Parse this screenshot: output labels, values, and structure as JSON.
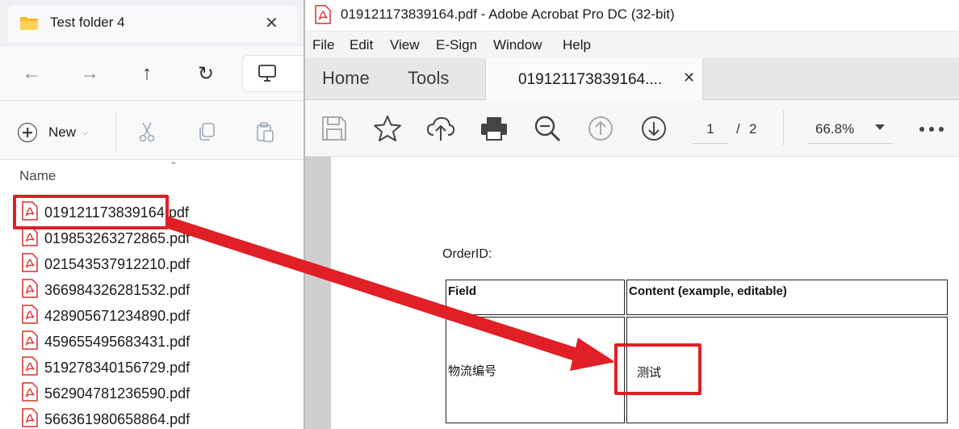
{
  "explorer": {
    "tab_title": "Test folder 4",
    "command_bar": {
      "new_label": "New"
    },
    "list": {
      "column_name": "Name",
      "files": [
        "019121173839164.pdf",
        "019853263272865.pdf",
        "021543537912210.pdf",
        "366984326281532.pdf",
        "428905671234890.pdf",
        "459655495683431.pdf",
        "519278340156729.pdf",
        "562904781236590.pdf",
        "566361980658864.pdf"
      ]
    }
  },
  "acrobat": {
    "window_title": "019121173839164.pdf - Adobe Acrobat Pro DC (32-bit)",
    "menu": [
      "File",
      "Edit",
      "View",
      "E-Sign",
      "Window",
      "Help"
    ],
    "tabs": {
      "home": "Home",
      "tools": "Tools",
      "document": "019121173839164...."
    },
    "toolbar": {
      "page_current": "1",
      "page_separator": "/",
      "page_total": "2",
      "zoom": "66.8%"
    },
    "document": {
      "order_label": "OrderID:",
      "table": {
        "header": [
          "Field",
          "Content (example, editable)"
        ],
        "rows": [
          [
            "物流编号",
            "测试"
          ]
        ]
      }
    }
  },
  "annotations": {
    "highlight_color": "#e01f26"
  }
}
